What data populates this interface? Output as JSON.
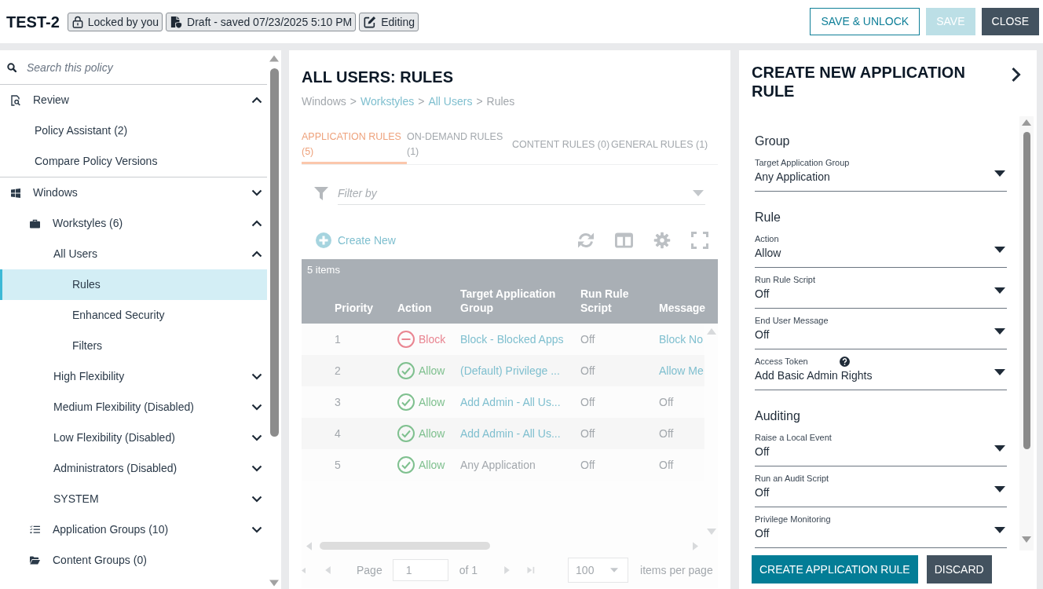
{
  "header": {
    "title": "TEST-2",
    "badges": [
      {
        "kind": "lock",
        "label": "Locked by you"
      },
      {
        "kind": "draft",
        "label": "Draft - saved 07/23/2025 5:10 PM"
      },
      {
        "kind": "edit",
        "label": "Editing"
      }
    ],
    "buttons": [
      {
        "kind": "outline",
        "label": "SAVE & UNLOCK",
        "disabled": false
      },
      {
        "kind": "primary",
        "label": "SAVE",
        "disabled": true
      },
      {
        "kind": "dark",
        "label": "CLOSE",
        "disabled": false
      }
    ]
  },
  "sidebar": {
    "search": {
      "placeholder": "Search this policy"
    },
    "tree": [
      {
        "kind": "review",
        "label": "Review",
        "expanded": true,
        "selected": false,
        "children": [
          {
            "label": "Policy Assistant (2)",
            "selected": false
          },
          {
            "label": "Compare Policy Versions",
            "selected": false
          }
        ]
      },
      {
        "kind": "windows",
        "label": "Windows",
        "expanded": false,
        "selected": false,
        "children": [
          {
            "kind": "workstyles",
            "label": "Workstyles (6)",
            "expanded": true,
            "selected": false,
            "children": [
              {
                "label": "All Users",
                "expanded": true,
                "selected": false,
                "children": [
                  {
                    "label": "Rules",
                    "selected": true
                  },
                  {
                    "label": "Enhanced Security",
                    "selected": false
                  },
                  {
                    "label": "Filters",
                    "selected": false
                  }
                ]
              },
              {
                "label": "High Flexibility",
                "expanded": false,
                "selected": false
              },
              {
                "label": "Medium Flexibility (Disabled)",
                "expanded": false,
                "selected": false
              },
              {
                "label": "Low Flexibility (Disabled)",
                "expanded": false,
                "selected": false
              },
              {
                "label": "Administrators (Disabled)",
                "expanded": false,
                "selected": false
              },
              {
                "label": "SYSTEM",
                "expanded": false,
                "selected": false
              }
            ]
          },
          {
            "kind": "application-groups",
            "label": "Application Groups (10)",
            "expanded": false,
            "selected": false
          },
          {
            "kind": "content-groups",
            "label": "Content Groups (0)",
            "selected": false
          }
        ]
      }
    ]
  },
  "main": {
    "title": "ALL USERS: RULES",
    "breadcrumb": [
      {
        "label": "Windows",
        "link": false
      },
      {
        "separator": ">",
        "label": "Workstyles",
        "link": true
      },
      {
        "separator": ">",
        "label": "All Users",
        "link": true
      },
      {
        "separator": ">",
        "label": "Rules",
        "link": false
      }
    ],
    "tabs": [
      {
        "label": "APPLICATION RULES (5)",
        "selected": true
      },
      {
        "label": "ON-DEMAND RULES (1)",
        "selected": false
      },
      {
        "label": "CONTENT RULES (0)",
        "selected": false
      },
      {
        "label": "GENERAL RULES (1)",
        "selected": false
      }
    ],
    "filter": {
      "placeholder": "Filter by"
    },
    "create_label": "Create New",
    "table": {
      "count": "5 items",
      "columns": [
        "Priority",
        "Action",
        "Target Application Group",
        "Run Rule Script",
        "Message"
      ],
      "rows": [
        {
          "priority": "1",
          "action": {
            "kind": "block",
            "label": "Block"
          },
          "target": {
            "label": "Block - Blocked Apps",
            "link": true
          },
          "script": "Off",
          "message": {
            "label": "Block No",
            "link": true
          }
        },
        {
          "priority": "2",
          "action": {
            "kind": "allow",
            "label": "Allow"
          },
          "target": {
            "label": "(Default) Privilege ...",
            "link": true
          },
          "script": "Off",
          "message": {
            "label": "Allow Me",
            "link": true
          }
        },
        {
          "priority": "3",
          "action": {
            "kind": "allow",
            "label": "Allow"
          },
          "target": {
            "label": "Add Admin - All Us...",
            "link": true
          },
          "script": "Off",
          "message": {
            "label": "Off",
            "link": false
          }
        },
        {
          "priority": "4",
          "action": {
            "kind": "allow",
            "label": "Allow"
          },
          "target": {
            "label": "Add Admin - All Us...",
            "link": true
          },
          "script": "Off",
          "message": {
            "label": "Off",
            "link": false
          }
        },
        {
          "priority": "5",
          "action": {
            "kind": "allow",
            "label": "Allow"
          },
          "target": {
            "label": "Any Application",
            "link": false
          },
          "script": "Off",
          "message": {
            "label": "Off",
            "link": false
          }
        }
      ]
    },
    "pagination": {
      "page_label": "Page",
      "page": "1",
      "page_count": "of 1",
      "page_size": "100",
      "page_size_label": "items per page"
    }
  },
  "panel": {
    "title": "CREATE NEW APPLICATION RULE",
    "sections": [
      {
        "heading": "Group",
        "fields": [
          {
            "label": "Target Application Group",
            "value": "Any Application",
            "help": false
          }
        ]
      },
      {
        "heading": "Rule",
        "fields": [
          {
            "label": "Action",
            "value": "Allow",
            "help": false
          },
          {
            "label": "Run Rule Script",
            "value": "Off",
            "help": false
          },
          {
            "label": "End User Message",
            "value": "Off",
            "help": false
          },
          {
            "label": "Access Token",
            "value": "Add Basic Admin Rights",
            "help": true
          }
        ]
      },
      {
        "heading": "Auditing",
        "fields": [
          {
            "label": "Raise a Local Event",
            "value": "Off",
            "help": false
          },
          {
            "label": "Run an Audit Script",
            "value": "Off",
            "help": false
          },
          {
            "label": "Privilege Monitoring",
            "value": "Off",
            "help": false
          }
        ]
      }
    ],
    "buttons": [
      {
        "kind": "primary",
        "label": "CREATE APPLICATION RULE",
        "disabled": false
      },
      {
        "kind": "dark",
        "label": "DISCARD",
        "disabled": false
      }
    ]
  }
}
